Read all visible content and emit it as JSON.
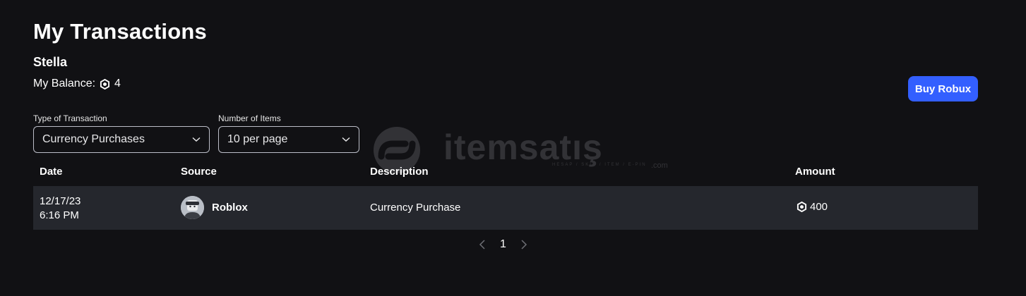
{
  "header": {
    "title": "My Transactions",
    "username": "Stella",
    "balance_label": "My Balance:",
    "balance_value": "4",
    "buy_button": "Buy Robux"
  },
  "filters": {
    "type_label": "Type of Transaction",
    "type_value": "Currency Purchases",
    "items_label": "Number of Items",
    "items_value": "10 per page"
  },
  "watermark": {
    "text": "itemsatış",
    "sub": "HESAP / SKIN / ITEM / E-PIN",
    "com": ".com"
  },
  "table": {
    "columns": [
      "Date",
      "Source",
      "Description",
      "Amount"
    ],
    "rows": [
      {
        "date": "12/17/23",
        "time": "6:16 PM",
        "source": "Roblox",
        "description": "Currency Purchase",
        "amount": "400"
      }
    ]
  },
  "pagination": {
    "current_page": "1"
  },
  "colors": {
    "background": "#111114",
    "row_background": "#25272d",
    "accent": "#335fff"
  },
  "icons": {
    "robux": "robux-icon",
    "dropdown": "chevron-down-icon",
    "prev": "chevron-left-icon",
    "next": "chevron-right-icon"
  }
}
